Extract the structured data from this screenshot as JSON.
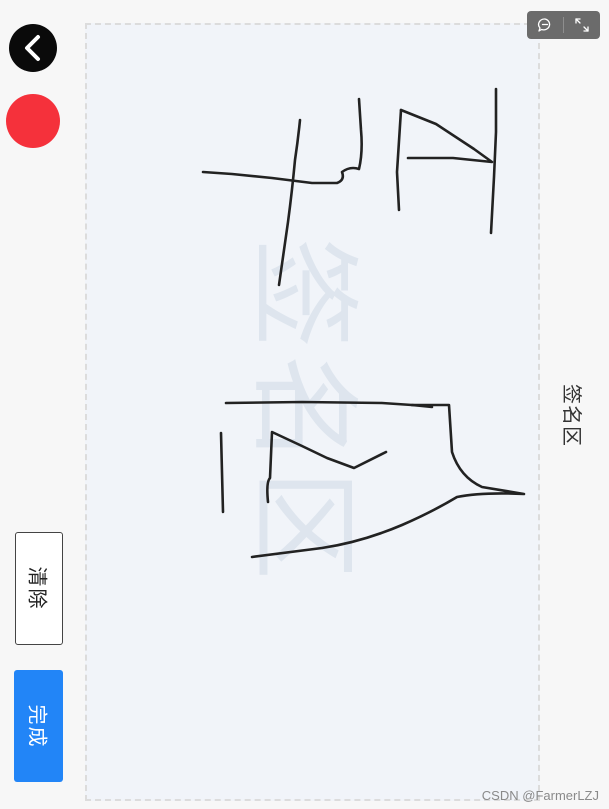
{
  "toolbar": {
    "back_icon": "chevron-left-icon",
    "pen_color": "#f5313b"
  },
  "actions": {
    "clear_label": "清除",
    "done_label": "完成",
    "done_color": "#2285f7"
  },
  "canvas": {
    "watermark_text": "签名区",
    "side_label": "签名区"
  },
  "top_toolbar": {
    "comment_icon": "comment-icon",
    "fullscreen_icon": "fullscreen-icon"
  },
  "footer": {
    "credit": "CSDN @FarmerLZJ"
  }
}
